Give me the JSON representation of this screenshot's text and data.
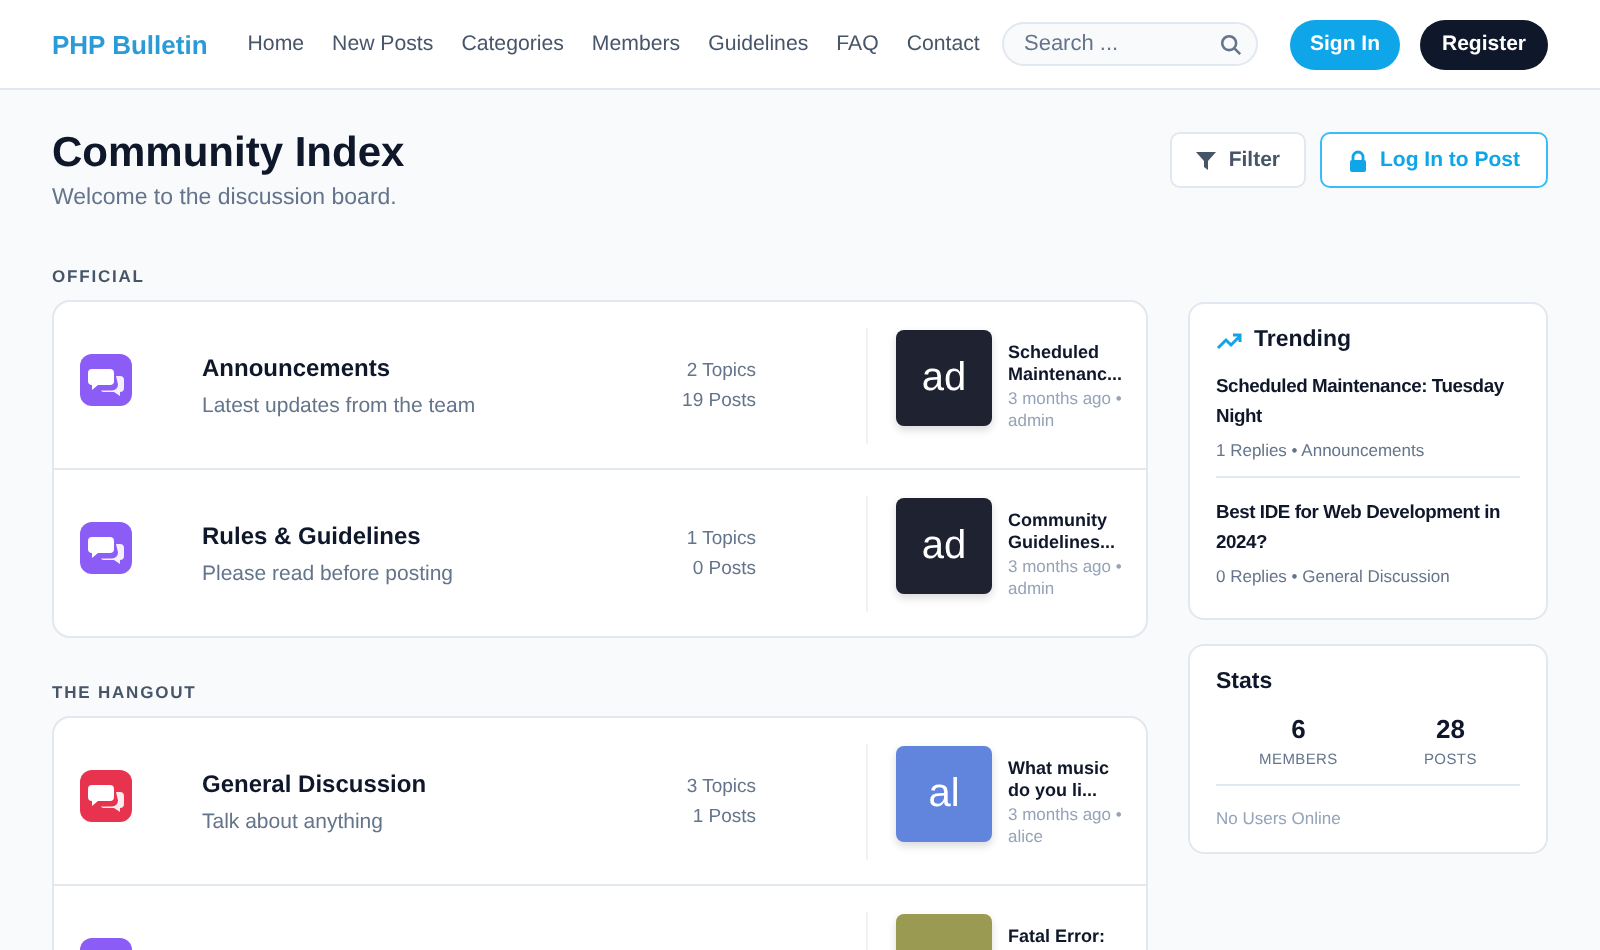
{
  "header": {
    "logo": "PHP Bulletin",
    "nav": [
      "Home",
      "New Posts",
      "Categories",
      "Members",
      "Guidelines",
      "FAQ",
      "Contact"
    ],
    "search": {
      "placeholder": "Search ..."
    },
    "buttons": [
      {
        "label": "Sign In",
        "kind": "primary"
      },
      {
        "label": "Register",
        "kind": "dark"
      }
    ]
  },
  "page": {
    "title": "Community Index",
    "subtitle": "Welcome to the discussion board.",
    "actions": [
      {
        "label": "Filter",
        "kind": "filter"
      },
      {
        "label": "Log In to Post",
        "kind": "login"
      }
    ]
  },
  "sections": [
    {
      "label": "OFFICIAL",
      "forums": [
        {
          "name": "Announcements",
          "description": "Latest updates from the team",
          "topics": "2 Topics",
          "posts": "19 Posts",
          "color": "#8b5cf6",
          "last_post": {
            "avatar": "ad",
            "color": "#1f2230",
            "title": "Scheduled Maintenanc...",
            "meta": "3 months ago • admin"
          }
        },
        {
          "name": "Rules & Guidelines",
          "description": "Please read before posting",
          "topics": "1 Topics",
          "posts": "0 Posts",
          "color": "#8b5cf6",
          "last_post": {
            "avatar": "ad",
            "color": "#1f2230",
            "title": "Community Guidelines...",
            "meta": "3 months ago • admin"
          }
        }
      ]
    },
    {
      "label": "THE HANGOUT",
      "forums": [
        {
          "name": "General Discussion",
          "description": "Talk about anything",
          "topics": "3 Topics",
          "posts": "1 Posts",
          "color": "#e8334f",
          "last_post": {
            "avatar": "al",
            "color": "#6184dd",
            "title": "What music do you li...",
            "meta": "3 months ago • alice"
          }
        },
        {
          "color": "#8b5cf6",
          "last_post": {
            "color": "#9b9a52",
            "title": "Fatal Error:"
          }
        }
      ]
    }
  ],
  "trending": {
    "title": "Trending",
    "items": [
      {
        "title": "Scheduled Maintenance: Tuesday Night",
        "meta": "1 Replies • Announcements"
      },
      {
        "title": "Best IDE for Web Development in 2024?",
        "meta": "0 Replies • General Discussion"
      }
    ]
  },
  "stats": {
    "title": "Stats",
    "items": [
      {
        "value": "6",
        "label": "MEMBERS"
      },
      {
        "value": "28",
        "label": "POSTS"
      }
    ],
    "footer": "No Users Online"
  }
}
